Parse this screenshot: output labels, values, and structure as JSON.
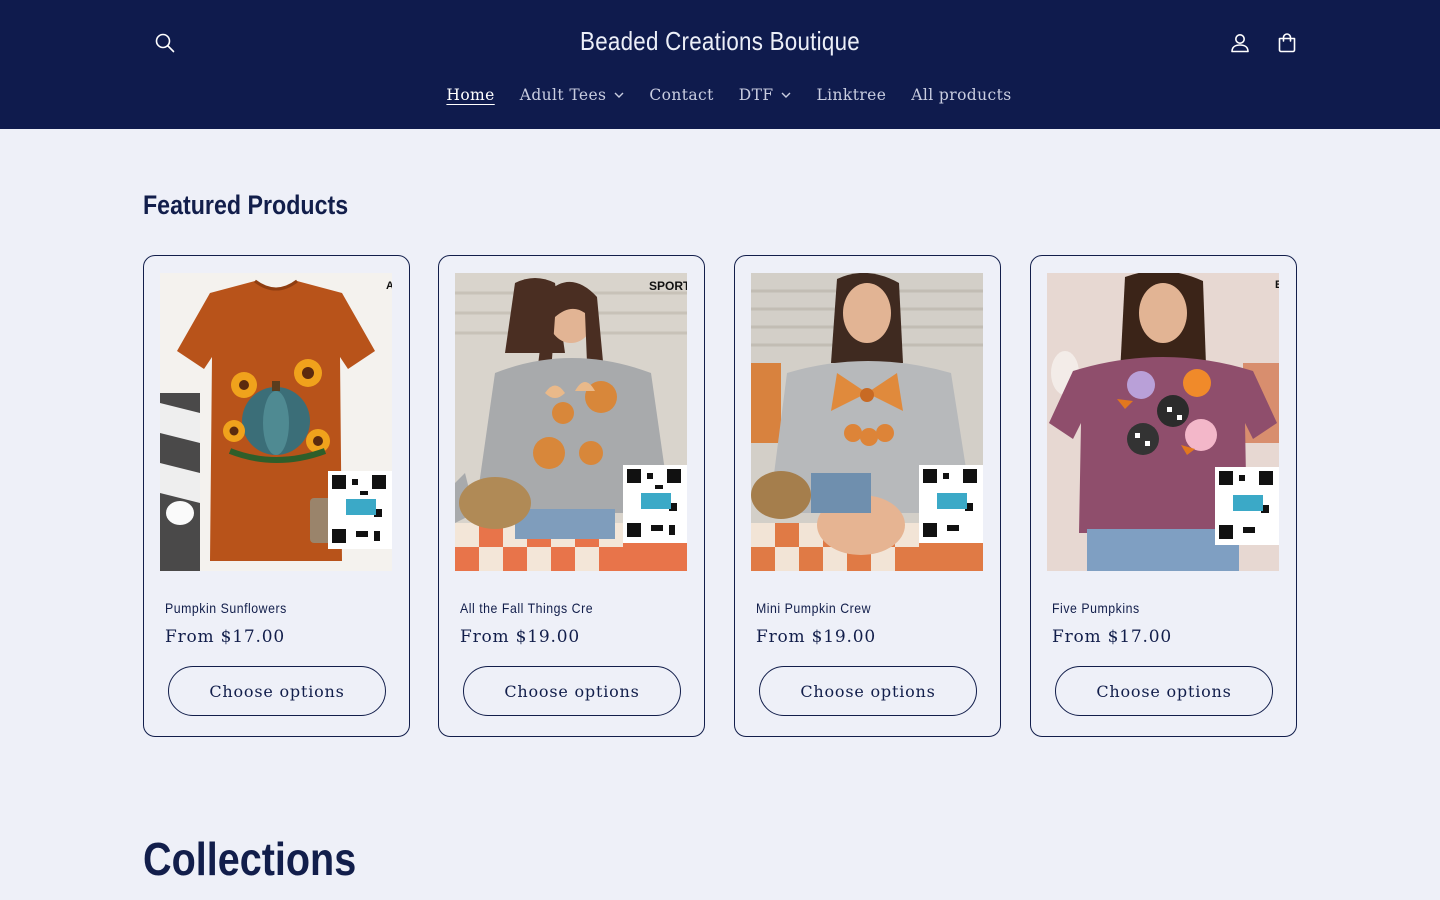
{
  "header": {
    "store_name": "Beaded Creations Boutique",
    "icons": {
      "search": "search-icon",
      "account": "account-icon",
      "cart": "cart-icon"
    },
    "background": "#0f1b4d"
  },
  "nav": {
    "items": [
      {
        "label": "Home",
        "active": true,
        "dropdown": false
      },
      {
        "label": "Adult Tees",
        "active": false,
        "dropdown": true
      },
      {
        "label": "Contact",
        "active": false,
        "dropdown": false
      },
      {
        "label": "DTF",
        "active": false,
        "dropdown": true
      },
      {
        "label": "Linktree",
        "active": false,
        "dropdown": false
      },
      {
        "label": "All products",
        "active": false,
        "dropdown": false
      }
    ]
  },
  "featured": {
    "title": "Featured Products",
    "products": [
      {
        "name": "Pumpkin Sunflowers",
        "price": "From $17.00",
        "button": "Choose options",
        "image_corner_text": "A"
      },
      {
        "name": "All the Fall Things Cre",
        "price": "From $19.00",
        "button": "Choose options",
        "image_corner_text": "SPORT"
      },
      {
        "name": "Mini Pumpkin Crew",
        "price": "From $19.00",
        "button": "Choose options",
        "image_corner_text": ""
      },
      {
        "name": "Five Pumpkins",
        "price": "From $17.00",
        "button": "Choose options",
        "image_corner_text": "E"
      }
    ]
  },
  "collections": {
    "title": "Collections"
  },
  "colors": {
    "page_bg": "#eef0f8",
    "text": "#121e4b",
    "header_bg": "#0f1b4d"
  }
}
